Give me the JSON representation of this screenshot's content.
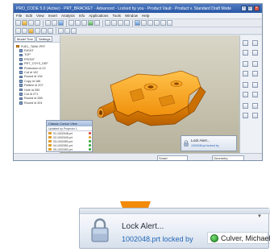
{
  "window": {
    "title": "PRO_CODE 5.0 (Active) - PRT_BRACKET - Advanced - Locked by you - Product Vault - Product v. Standard Draft Mode",
    "menu": [
      "File",
      "Edit",
      "View",
      "Insert",
      "Analysis",
      "Info",
      "Applications",
      "Tools",
      "Window",
      "Help"
    ],
    "left_tabs": [
      "Model Tree",
      "Settings"
    ],
    "tree_items": [
      {
        "label": "FUEL_TANK.PRT",
        "level": 0
      },
      {
        "label": "RIGHT",
        "level": 1
      },
      {
        "label": "TOP",
        "level": 1
      },
      {
        "label": "FRONT",
        "level": 1
      },
      {
        "label": "PRT_CSYS_DEF",
        "level": 1
      },
      {
        "label": "Protrusion id 22",
        "level": 1
      },
      {
        "label": "Cut id 102",
        "level": 1
      },
      {
        "label": "Round id 134",
        "level": 1
      },
      {
        "label": "Copy id 186",
        "level": 1
      },
      {
        "label": "Pattern id 207",
        "level": 1
      },
      {
        "label": "Hole id 250",
        "level": 1
      },
      {
        "label": "Cut id 271",
        "level": 1
      },
      {
        "label": "Round id 288",
        "level": 1
      },
      {
        "label": "Round id 301",
        "level": 1
      }
    ],
    "float_panel": {
      "title": "Classic Cursor View",
      "subtitle": "Updated by Projector 1",
      "rows": [
        "01-1002048.prt",
        "02-1002049.prt",
        "03-1002050.prt",
        "04-1002051.prt",
        "05-1002052.prt"
      ]
    },
    "mini_toast": {
      "title": "Lock Alert...",
      "body": "1002048.prt locked by"
    },
    "status": {
      "filter": "Smart",
      "mode": "Geometry"
    }
  },
  "alert": {
    "title": "Lock Alert...",
    "message": "1002048.prt locked by",
    "user": "Culver, Michael",
    "menu_glyph": "▼",
    "user_status_color": "#2aa52f",
    "accent_color": "#f28a0a"
  }
}
